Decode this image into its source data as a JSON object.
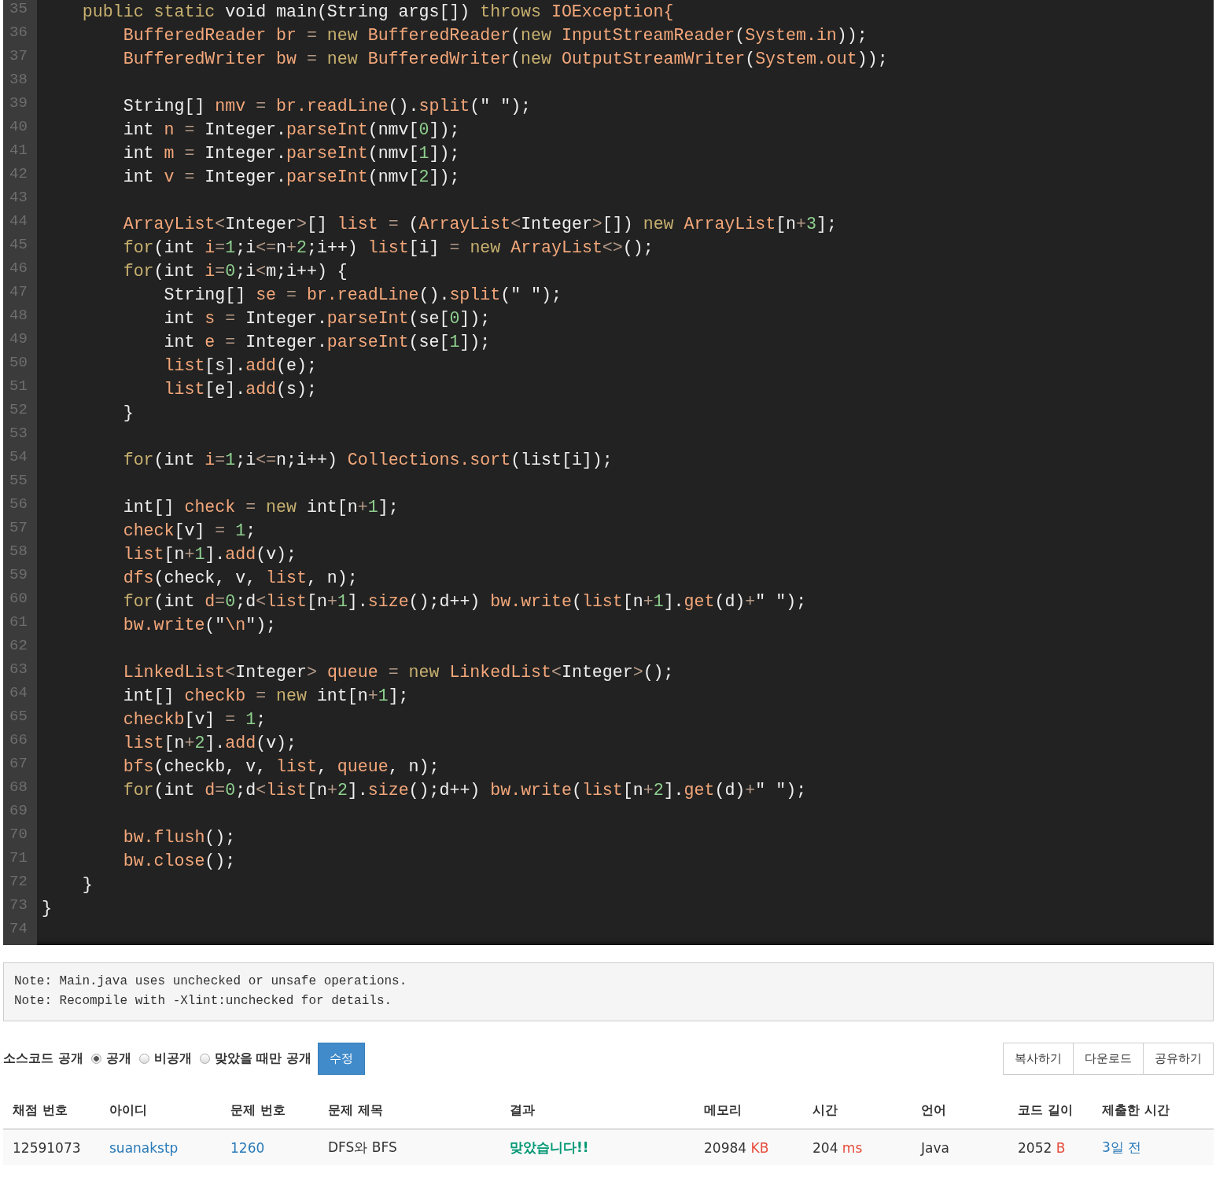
{
  "code_lines": [
    {
      "number": "35",
      "tokens": [
        {
          "kind": "keyword",
          "text": "    public static "
        },
        {
          "kind": "plain",
          "text": "void main(String args[]) "
        },
        {
          "kind": "keyword",
          "text": "throws "
        },
        {
          "kind": "name",
          "text": "IOException{"
        }
      ]
    },
    {
      "number": "36",
      "tokens": [
        {
          "kind": "name",
          "text": "        BufferedReader br "
        },
        {
          "kind": "operator",
          "text": "= "
        },
        {
          "kind": "keyword",
          "text": "new "
        },
        {
          "kind": "name",
          "text": "BufferedReader"
        },
        {
          "kind": "plain",
          "text": "("
        },
        {
          "kind": "keyword",
          "text": "new "
        },
        {
          "kind": "name",
          "text": "InputStreamReader"
        },
        {
          "kind": "plain",
          "text": "("
        },
        {
          "kind": "name",
          "text": "System.in"
        },
        {
          "kind": "plain",
          "text": "));"
        }
      ]
    },
    {
      "number": "37",
      "tokens": [
        {
          "kind": "name",
          "text": "        BufferedWriter bw "
        },
        {
          "kind": "operator",
          "text": "= "
        },
        {
          "kind": "keyword",
          "text": "new "
        },
        {
          "kind": "name",
          "text": "BufferedWriter"
        },
        {
          "kind": "plain",
          "text": "("
        },
        {
          "kind": "keyword",
          "text": "new "
        },
        {
          "kind": "name",
          "text": "OutputStreamWriter"
        },
        {
          "kind": "plain",
          "text": "("
        },
        {
          "kind": "name",
          "text": "System.out"
        },
        {
          "kind": "plain",
          "text": "));"
        }
      ]
    },
    {
      "number": "38"
    },
    {
      "number": "39",
      "tokens": [
        {
          "kind": "plain",
          "text": "        String[] "
        },
        {
          "kind": "name",
          "text": "nmv "
        },
        {
          "kind": "operator",
          "text": "= "
        },
        {
          "kind": "name",
          "text": "br.readLine"
        },
        {
          "kind": "plain",
          "text": "()."
        },
        {
          "kind": "name",
          "text": "split"
        },
        {
          "kind": "plain",
          "text": "(\" \");"
        }
      ]
    },
    {
      "number": "40",
      "tokens": [
        {
          "kind": "plain",
          "text": "        int "
        },
        {
          "kind": "name",
          "text": "n "
        },
        {
          "kind": "operator",
          "text": "= "
        },
        {
          "kind": "plain",
          "text": "Integer."
        },
        {
          "kind": "name",
          "text": "parseInt"
        },
        {
          "kind": "plain",
          "text": "(nmv["
        },
        {
          "kind": "number",
          "text": "0"
        },
        {
          "kind": "plain",
          "text": "]);"
        }
      ]
    },
    {
      "number": "41",
      "tokens": [
        {
          "kind": "plain",
          "text": "        int "
        },
        {
          "kind": "name",
          "text": "m "
        },
        {
          "kind": "operator",
          "text": "= "
        },
        {
          "kind": "plain",
          "text": "Integer."
        },
        {
          "kind": "name",
          "text": "parseInt"
        },
        {
          "kind": "plain",
          "text": "(nmv["
        },
        {
          "kind": "number",
          "text": "1"
        },
        {
          "kind": "plain",
          "text": "]);"
        }
      ]
    },
    {
      "number": "42",
      "tokens": [
        {
          "kind": "plain",
          "text": "        int "
        },
        {
          "kind": "name",
          "text": "v "
        },
        {
          "kind": "operator",
          "text": "= "
        },
        {
          "kind": "plain",
          "text": "Integer."
        },
        {
          "kind": "name",
          "text": "parseInt"
        },
        {
          "kind": "plain",
          "text": "(nmv["
        },
        {
          "kind": "number",
          "text": "2"
        },
        {
          "kind": "plain",
          "text": "]);"
        }
      ]
    },
    {
      "number": "43"
    },
    {
      "number": "44",
      "tokens": [
        {
          "kind": "name",
          "text": "        ArrayList"
        },
        {
          "kind": "operator",
          "text": "<"
        },
        {
          "kind": "plain",
          "text": "Integer"
        },
        {
          "kind": "operator",
          "text": ">"
        },
        {
          "kind": "plain",
          "text": "[] "
        },
        {
          "kind": "name",
          "text": "list "
        },
        {
          "kind": "operator",
          "text": "= "
        },
        {
          "kind": "plain",
          "text": "("
        },
        {
          "kind": "name",
          "text": "ArrayList"
        },
        {
          "kind": "operator",
          "text": "<"
        },
        {
          "kind": "plain",
          "text": "Integer"
        },
        {
          "kind": "operator",
          "text": ">"
        },
        {
          "kind": "plain",
          "text": "[]) "
        },
        {
          "kind": "keyword",
          "text": "new "
        },
        {
          "kind": "name",
          "text": "ArrayList"
        },
        {
          "kind": "plain",
          "text": "[n"
        },
        {
          "kind": "operator",
          "text": "+"
        },
        {
          "kind": "number",
          "text": "3"
        },
        {
          "kind": "plain",
          "text": "];"
        }
      ]
    },
    {
      "number": "45",
      "tokens": [
        {
          "kind": "keyword",
          "text": "        for"
        },
        {
          "kind": "plain",
          "text": "(int "
        },
        {
          "kind": "name",
          "text": "i"
        },
        {
          "kind": "operator",
          "text": "="
        },
        {
          "kind": "number",
          "text": "1"
        },
        {
          "kind": "plain",
          "text": ";i"
        },
        {
          "kind": "operator",
          "text": "<="
        },
        {
          "kind": "plain",
          "text": "n"
        },
        {
          "kind": "operator",
          "text": "+"
        },
        {
          "kind": "number",
          "text": "2"
        },
        {
          "kind": "plain",
          "text": ";i++) "
        },
        {
          "kind": "name",
          "text": "list"
        },
        {
          "kind": "plain",
          "text": "[i] "
        },
        {
          "kind": "operator",
          "text": "= "
        },
        {
          "kind": "keyword",
          "text": "new "
        },
        {
          "kind": "name",
          "text": "ArrayList"
        },
        {
          "kind": "operator",
          "text": "<>"
        },
        {
          "kind": "plain",
          "text": "();"
        }
      ]
    },
    {
      "number": "46",
      "tokens": [
        {
          "kind": "keyword",
          "text": "        for"
        },
        {
          "kind": "plain",
          "text": "(int "
        },
        {
          "kind": "name",
          "text": "i"
        },
        {
          "kind": "operator",
          "text": "="
        },
        {
          "kind": "number",
          "text": "0"
        },
        {
          "kind": "plain",
          "text": ";i"
        },
        {
          "kind": "operator",
          "text": "<"
        },
        {
          "kind": "plain",
          "text": "m;i++) {"
        }
      ]
    },
    {
      "number": "47",
      "tokens": [
        {
          "kind": "plain",
          "text": "            String[] "
        },
        {
          "kind": "name",
          "text": "se "
        },
        {
          "kind": "operator",
          "text": "= "
        },
        {
          "kind": "name",
          "text": "br.readLine"
        },
        {
          "kind": "plain",
          "text": "()."
        },
        {
          "kind": "name",
          "text": "split"
        },
        {
          "kind": "plain",
          "text": "(\" \");"
        }
      ]
    },
    {
      "number": "48",
      "tokens": [
        {
          "kind": "plain",
          "text": "            int "
        },
        {
          "kind": "name",
          "text": "s "
        },
        {
          "kind": "operator",
          "text": "= "
        },
        {
          "kind": "plain",
          "text": "Integer."
        },
        {
          "kind": "name",
          "text": "parseInt"
        },
        {
          "kind": "plain",
          "text": "(se["
        },
        {
          "kind": "number",
          "text": "0"
        },
        {
          "kind": "plain",
          "text": "]);"
        }
      ]
    },
    {
      "number": "49",
      "tokens": [
        {
          "kind": "plain",
          "text": "            int "
        },
        {
          "kind": "name",
          "text": "e "
        },
        {
          "kind": "operator",
          "text": "= "
        },
        {
          "kind": "plain",
          "text": "Integer."
        },
        {
          "kind": "name",
          "text": "parseInt"
        },
        {
          "kind": "plain",
          "text": "(se["
        },
        {
          "kind": "number",
          "text": "1"
        },
        {
          "kind": "plain",
          "text": "]);"
        }
      ]
    },
    {
      "number": "50",
      "tokens": [
        {
          "kind": "name",
          "text": "            list"
        },
        {
          "kind": "plain",
          "text": "[s]."
        },
        {
          "kind": "name",
          "text": "add"
        },
        {
          "kind": "plain",
          "text": "(e);"
        }
      ]
    },
    {
      "number": "51",
      "tokens": [
        {
          "kind": "name",
          "text": "            list"
        },
        {
          "kind": "plain",
          "text": "[e]."
        },
        {
          "kind": "name",
          "text": "add"
        },
        {
          "kind": "plain",
          "text": "(s);"
        }
      ]
    },
    {
      "number": "52",
      "tokens": [
        {
          "kind": "plain",
          "text": "        }"
        }
      ]
    },
    {
      "number": "53"
    },
    {
      "number": "54",
      "tokens": [
        {
          "kind": "keyword",
          "text": "        for"
        },
        {
          "kind": "plain",
          "text": "(int "
        },
        {
          "kind": "name",
          "text": "i"
        },
        {
          "kind": "operator",
          "text": "="
        },
        {
          "kind": "number",
          "text": "1"
        },
        {
          "kind": "plain",
          "text": ";i"
        },
        {
          "kind": "operator",
          "text": "<="
        },
        {
          "kind": "plain",
          "text": "n;i++) "
        },
        {
          "kind": "name",
          "text": "Collections.sort"
        },
        {
          "kind": "plain",
          "text": "(list[i]);"
        }
      ]
    },
    {
      "number": "55"
    },
    {
      "number": "56",
      "tokens": [
        {
          "kind": "plain",
          "text": "        int[] "
        },
        {
          "kind": "name",
          "text": "check "
        },
        {
          "kind": "operator",
          "text": "= "
        },
        {
          "kind": "keyword",
          "text": "new "
        },
        {
          "kind": "plain",
          "text": "int[n"
        },
        {
          "kind": "operator",
          "text": "+"
        },
        {
          "kind": "number",
          "text": "1"
        },
        {
          "kind": "plain",
          "text": "];"
        }
      ]
    },
    {
      "number": "57",
      "tokens": [
        {
          "kind": "name",
          "text": "        check"
        },
        {
          "kind": "plain",
          "text": "[v] "
        },
        {
          "kind": "operator",
          "text": "= "
        },
        {
          "kind": "number",
          "text": "1"
        },
        {
          "kind": "plain",
          "text": ";"
        }
      ]
    },
    {
      "number": "58",
      "tokens": [
        {
          "kind": "name",
          "text": "        list"
        },
        {
          "kind": "plain",
          "text": "[n"
        },
        {
          "kind": "operator",
          "text": "+"
        },
        {
          "kind": "number",
          "text": "1"
        },
        {
          "kind": "plain",
          "text": "]."
        },
        {
          "kind": "name",
          "text": "add"
        },
        {
          "kind": "plain",
          "text": "(v);"
        }
      ]
    },
    {
      "number": "59",
      "tokens": [
        {
          "kind": "name",
          "text": "        dfs"
        },
        {
          "kind": "plain",
          "text": "(check, v, "
        },
        {
          "kind": "name",
          "text": "list"
        },
        {
          "kind": "plain",
          "text": ", n);"
        }
      ]
    },
    {
      "number": "60",
      "tokens": [
        {
          "kind": "keyword",
          "text": "        for"
        },
        {
          "kind": "plain",
          "text": "(int "
        },
        {
          "kind": "name",
          "text": "d"
        },
        {
          "kind": "operator",
          "text": "="
        },
        {
          "kind": "number",
          "text": "0"
        },
        {
          "kind": "plain",
          "text": ";d"
        },
        {
          "kind": "operator",
          "text": "<"
        },
        {
          "kind": "name",
          "text": "list"
        },
        {
          "kind": "plain",
          "text": "[n"
        },
        {
          "kind": "operator",
          "text": "+"
        },
        {
          "kind": "number",
          "text": "1"
        },
        {
          "kind": "plain",
          "text": "]."
        },
        {
          "kind": "name",
          "text": "size"
        },
        {
          "kind": "plain",
          "text": "();d++) "
        },
        {
          "kind": "name",
          "text": "bw.write"
        },
        {
          "kind": "plain",
          "text": "("
        },
        {
          "kind": "name",
          "text": "list"
        },
        {
          "kind": "plain",
          "text": "[n"
        },
        {
          "kind": "operator",
          "text": "+"
        },
        {
          "kind": "number",
          "text": "1"
        },
        {
          "kind": "plain",
          "text": "]."
        },
        {
          "kind": "name",
          "text": "get"
        },
        {
          "kind": "plain",
          "text": "(d)"
        },
        {
          "kind": "operator",
          "text": "+"
        },
        {
          "kind": "plain",
          "text": "\" \");"
        }
      ]
    },
    {
      "number": "61",
      "tokens": [
        {
          "kind": "name",
          "text": "        bw.write"
        },
        {
          "kind": "plain",
          "text": "(\""
        },
        {
          "kind": "name",
          "text": "\\n"
        },
        {
          "kind": "plain",
          "text": "\");"
        }
      ]
    },
    {
      "number": "62"
    },
    {
      "number": "63",
      "tokens": [
        {
          "kind": "name",
          "text": "        LinkedList"
        },
        {
          "kind": "operator",
          "text": "<"
        },
        {
          "kind": "plain",
          "text": "Integer"
        },
        {
          "kind": "operator",
          "text": "> "
        },
        {
          "kind": "name",
          "text": "queue "
        },
        {
          "kind": "operator",
          "text": "= "
        },
        {
          "kind": "keyword",
          "text": "new "
        },
        {
          "kind": "name",
          "text": "LinkedList"
        },
        {
          "kind": "operator",
          "text": "<"
        },
        {
          "kind": "plain",
          "text": "Integer"
        },
        {
          "kind": "operator",
          "text": ">"
        },
        {
          "kind": "plain",
          "text": "();"
        }
      ]
    },
    {
      "number": "64",
      "tokens": [
        {
          "kind": "plain",
          "text": "        int[] "
        },
        {
          "kind": "name",
          "text": "checkb "
        },
        {
          "kind": "operator",
          "text": "= "
        },
        {
          "kind": "keyword",
          "text": "new "
        },
        {
          "kind": "plain",
          "text": "int[n"
        },
        {
          "kind": "operator",
          "text": "+"
        },
        {
          "kind": "number",
          "text": "1"
        },
        {
          "kind": "plain",
          "text": "];"
        }
      ]
    },
    {
      "number": "65",
      "tokens": [
        {
          "kind": "name",
          "text": "        checkb"
        },
        {
          "kind": "plain",
          "text": "[v] "
        },
        {
          "kind": "operator",
          "text": "= "
        },
        {
          "kind": "number",
          "text": "1"
        },
        {
          "kind": "plain",
          "text": ";"
        }
      ]
    },
    {
      "number": "66",
      "tokens": [
        {
          "kind": "name",
          "text": "        list"
        },
        {
          "kind": "plain",
          "text": "[n"
        },
        {
          "kind": "operator",
          "text": "+"
        },
        {
          "kind": "number",
          "text": "2"
        },
        {
          "kind": "plain",
          "text": "]."
        },
        {
          "kind": "name",
          "text": "add"
        },
        {
          "kind": "plain",
          "text": "(v);"
        }
      ]
    },
    {
      "number": "67",
      "tokens": [
        {
          "kind": "name",
          "text": "        bfs"
        },
        {
          "kind": "plain",
          "text": "(checkb, v, "
        },
        {
          "kind": "name",
          "text": "list"
        },
        {
          "kind": "plain",
          "text": ", "
        },
        {
          "kind": "name",
          "text": "queue"
        },
        {
          "kind": "plain",
          "text": ", n);"
        }
      ]
    },
    {
      "number": "68",
      "tokens": [
        {
          "kind": "keyword",
          "text": "        for"
        },
        {
          "kind": "plain",
          "text": "(int "
        },
        {
          "kind": "name",
          "text": "d"
        },
        {
          "kind": "operator",
          "text": "="
        },
        {
          "kind": "number",
          "text": "0"
        },
        {
          "kind": "plain",
          "text": ";d"
        },
        {
          "kind": "operator",
          "text": "<"
        },
        {
          "kind": "name",
          "text": "list"
        },
        {
          "kind": "plain",
          "text": "[n"
        },
        {
          "kind": "operator",
          "text": "+"
        },
        {
          "kind": "number",
          "text": "2"
        },
        {
          "kind": "plain",
          "text": "]."
        },
        {
          "kind": "name",
          "text": "size"
        },
        {
          "kind": "plain",
          "text": "();d++) "
        },
        {
          "kind": "name",
          "text": "bw.write"
        },
        {
          "kind": "plain",
          "text": "("
        },
        {
          "kind": "name",
          "text": "list"
        },
        {
          "kind": "plain",
          "text": "[n"
        },
        {
          "kind": "operator",
          "text": "+"
        },
        {
          "kind": "number",
          "text": "2"
        },
        {
          "kind": "plain",
          "text": "]."
        },
        {
          "kind": "name",
          "text": "get"
        },
        {
          "kind": "plain",
          "text": "(d)"
        },
        {
          "kind": "operator",
          "text": "+"
        },
        {
          "kind": "plain",
          "text": "\" \");"
        }
      ]
    },
    {
      "number": "69"
    },
    {
      "number": "70",
      "tokens": [
        {
          "kind": "name",
          "text": "        bw.flush"
        },
        {
          "kind": "plain",
          "text": "();"
        }
      ]
    },
    {
      "number": "71",
      "tokens": [
        {
          "kind": "name",
          "text": "        bw.close"
        },
        {
          "kind": "plain",
          "text": "();"
        }
      ]
    },
    {
      "number": "72",
      "tokens": [
        {
          "kind": "plain",
          "text": "    }"
        }
      ]
    },
    {
      "number": "73",
      "tokens": [
        {
          "kind": "plain",
          "text": "}"
        }
      ]
    },
    {
      "number": "74"
    }
  ],
  "compiler_output": [
    "Note: Main.java uses unchecked or unsafe operations.",
    "Note: Recompile with -Xlint:unchecked for details."
  ],
  "source_visibility": {
    "label": "소스코드 공개",
    "options": [
      {
        "label": "공개",
        "selected": true
      },
      {
        "label": "비공개",
        "selected": false
      },
      {
        "label": "맞았을 때만 공개",
        "selected": false
      }
    ],
    "submit": "수정"
  },
  "actions": [
    "복사하기",
    "다운로드",
    "공유하기"
  ],
  "table": {
    "columns": [
      "채점 번호",
      "아이디",
      "문제 번호",
      "문제 제목",
      "결과",
      "메모리",
      "시간",
      "언어",
      "코드 길이",
      "제출한 시간"
    ],
    "rows": [
      {
        "cells": [
          {
            "kind": "plain",
            "text": "12591073"
          },
          {
            "kind": "link",
            "text": "suanakstp"
          },
          {
            "kind": "link",
            "text": "1260"
          },
          {
            "kind": "plain",
            "text": "DFS와 BFS"
          },
          {
            "kind": "success",
            "text": "맞았습니다!!"
          },
          {
            "kind": "plain",
            "text": "20984",
            "unit": "KB"
          },
          {
            "kind": "plain",
            "text": "204",
            "unit": "ms"
          },
          {
            "kind": "plain",
            "text": "Java"
          },
          {
            "kind": "plain",
            "text": "2052",
            "unit": "B"
          },
          {
            "kind": "link",
            "text": "3일 전"
          }
        ]
      }
    ]
  }
}
